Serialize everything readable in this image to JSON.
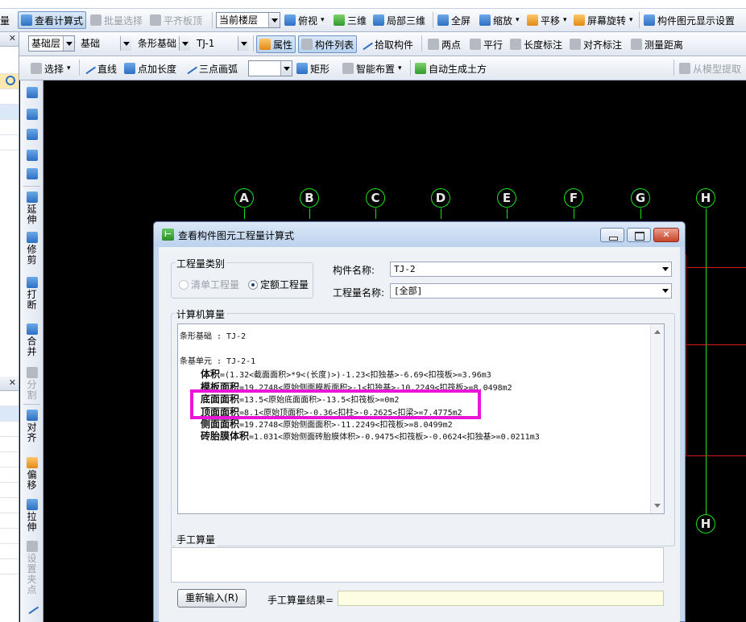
{
  "toolbar_top": {
    "partial_left": "量",
    "view_calc": "查看计算式",
    "batch_select": "批量选择",
    "level_slab": "平齐板顶",
    "floor_select": "当前楼层",
    "view_top": "俯视",
    "view_3d": "三维",
    "view_local_3d": "局部三维",
    "fullscreen": "全屏",
    "zoom": "缩放",
    "pan": "平移",
    "rotate_screen": "屏幕旋转",
    "display_settings": "构件图元显示设置"
  },
  "toolbar_mid": {
    "layer": "基础层",
    "category": "基础",
    "type": "条形基础",
    "element": "TJ-1",
    "properties": "属性",
    "component_list": "构件列表",
    "pick_component": "拾取构件",
    "two_points": "两点",
    "parallel": "平行",
    "length_dim": "长度标注",
    "aligned_dim": "对齐标注",
    "measure": "测量距离"
  },
  "toolbar_draw": {
    "select": "选择",
    "line": "直线",
    "point_length": "点加长度",
    "arc": "三点画弧",
    "rect": "矩形",
    "smart_layout": "智能布置",
    "auto_earthwork": "自动生成土方",
    "extract_from_model": "从模型提取"
  },
  "left_tools": {
    "extend": "延伸",
    "trim": "修剪",
    "break": "打断",
    "merge": "合并",
    "split": "分割",
    "align": "对齐",
    "offset": "偏移",
    "stretch": "拉伸",
    "set_grip": "设置夹点"
  },
  "canvas": {
    "axes": [
      "A",
      "B",
      "C",
      "D",
      "E",
      "F",
      "G",
      "H"
    ],
    "axis_bottom": "H"
  },
  "dialog": {
    "title": "查看构件图元工程量计算式",
    "quantity_type_label": "工程量类别",
    "radio_bill": "清单工程量",
    "radio_quota": "定额工程量",
    "component_name_label": "构件名称:",
    "component_name_value": "TJ-2",
    "quantity_name_label": "工程量名称:",
    "quantity_name_value": "[全部]",
    "computer_calc_label": "计算机算量",
    "calc": {
      "line1": "条形基础 : TJ-2",
      "line2": "条基单元 : TJ-2-1",
      "volume_label": "体积",
      "volume_expr": "=(1.32<截面面积>*9<(长度)>)-1.23<扣独基>-6.69<扣筏板>=3.96m3",
      "formwork_label": "模板面积",
      "formwork_expr": "=19.2748<原始侧面模板面积>-1<扣独基>-10.2249<扣筏板>=8.0498m2",
      "bottom_label": "底面面积",
      "bottom_expr": "=13.5<原始底面面积>-13.5<扣筏板>=0m2",
      "top_label": "顶面面积",
      "top_expr": "=8.1<原始顶面积>-0.36<扣柱>-0.2625<扣梁>=7.4775m2",
      "side_label": "侧面面积",
      "side_expr": "=19.2748<原始侧面面积>-11.2249<扣筏板>=8.0499m2",
      "brick_label": "砖胎膜体积",
      "brick_expr": "=1.031<原始侧面砖胎膜体积>-0.9475<扣筏板>-0.0624<扣独基>=0.0211m3"
    },
    "manual_calc_label": "手工算量",
    "reenter_button": "重新输入(R)",
    "manual_result_label": "手工算量结果="
  }
}
